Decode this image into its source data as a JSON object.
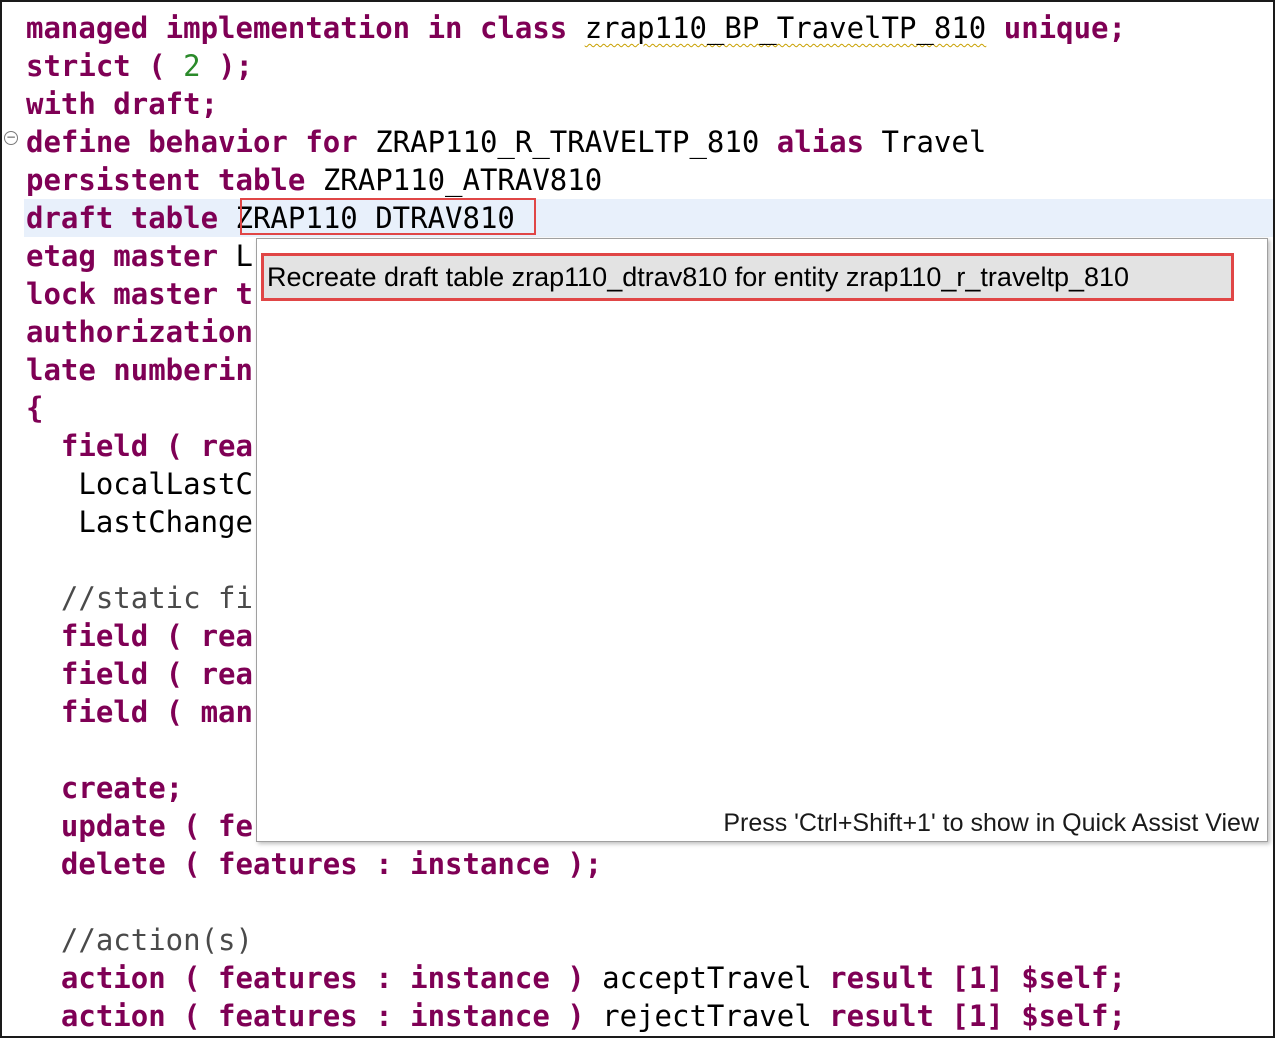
{
  "editor": {
    "lines": [
      [
        {
          "t": "managed implementation in class ",
          "c": "kw"
        },
        {
          "t": "zrap110_BP_TravelTP_810",
          "c": "squig"
        },
        {
          "t": " unique;",
          "c": "kw"
        }
      ],
      [
        {
          "t": "strict ( ",
          "c": "kw"
        },
        {
          "t": "2",
          "c": "num"
        },
        {
          "t": " );",
          "c": "kw"
        }
      ],
      [
        {
          "t": "with draft;",
          "c": "kw"
        }
      ],
      [
        {
          "t": "define behavior for ",
          "c": "kw"
        },
        {
          "t": "ZRAP110_R_TRAVELTP_810 ",
          "c": ""
        },
        {
          "t": "alias ",
          "c": "kw"
        },
        {
          "t": "Travel",
          "c": ""
        }
      ],
      [
        {
          "t": "persistent table ",
          "c": "kw"
        },
        {
          "t": "ZRAP110_ATRAV810",
          "c": ""
        }
      ],
      [
        {
          "t": "draft table ",
          "c": "kw"
        },
        {
          "t": "ZRAP110_DTRAV810",
          "c": ""
        }
      ],
      [
        {
          "t": "etag master ",
          "c": "kw"
        },
        {
          "t": "L",
          "c": ""
        }
      ],
      [
        {
          "t": "lock master t",
          "c": "kw"
        }
      ],
      [
        {
          "t": "authorization",
          "c": "kw"
        }
      ],
      [
        {
          "t": "late numberin",
          "c": "kw"
        }
      ],
      [
        {
          "t": "{",
          "c": "kw"
        }
      ],
      [
        {
          "t": "  field ( rea",
          "c": "kw"
        }
      ],
      [
        {
          "t": "   LocalLastC",
          "c": ""
        }
      ],
      [
        {
          "t": "   LastChange",
          "c": ""
        }
      ],
      [],
      [
        {
          "t": "  //static fi",
          "c": "cm"
        }
      ],
      [
        {
          "t": "  field ( rea",
          "c": "kw"
        }
      ],
      [
        {
          "t": "  field ( rea",
          "c": "kw"
        }
      ],
      [
        {
          "t": "  field ( man",
          "c": "kw"
        }
      ],
      [],
      [
        {
          "t": "  create;",
          "c": "kw"
        }
      ],
      [
        {
          "t": "  update ( fe",
          "c": "kw"
        }
      ],
      [
        {
          "t": "  delete ( features : instance );",
          "c": "kw"
        }
      ],
      [],
      [
        {
          "t": "  //action(s)",
          "c": "cm"
        }
      ],
      [
        {
          "t": "  action ( features : instance ) ",
          "c": "kw"
        },
        {
          "t": "acceptTravel ",
          "c": ""
        },
        {
          "t": "result [1] $self;",
          "c": "kw"
        }
      ],
      [
        {
          "t": "  action ( features : instance ) ",
          "c": "kw"
        },
        {
          "t": "rejectTravel ",
          "c": ""
        },
        {
          "t": "result [1] $self;",
          "c": "kw"
        }
      ]
    ]
  },
  "quick_assist": {
    "proposal": "Recreate draft table zrap110_dtrav810 for entity zrap110_r_traveltp_810",
    "footer_hint": "Press 'Ctrl+Shift+1' to show in Quick Assist View"
  },
  "colors": {
    "keyword": "#7f0055",
    "number": "#2a8a2a",
    "highlight_border": "#e04646",
    "current_line": "#e8f0fb"
  }
}
